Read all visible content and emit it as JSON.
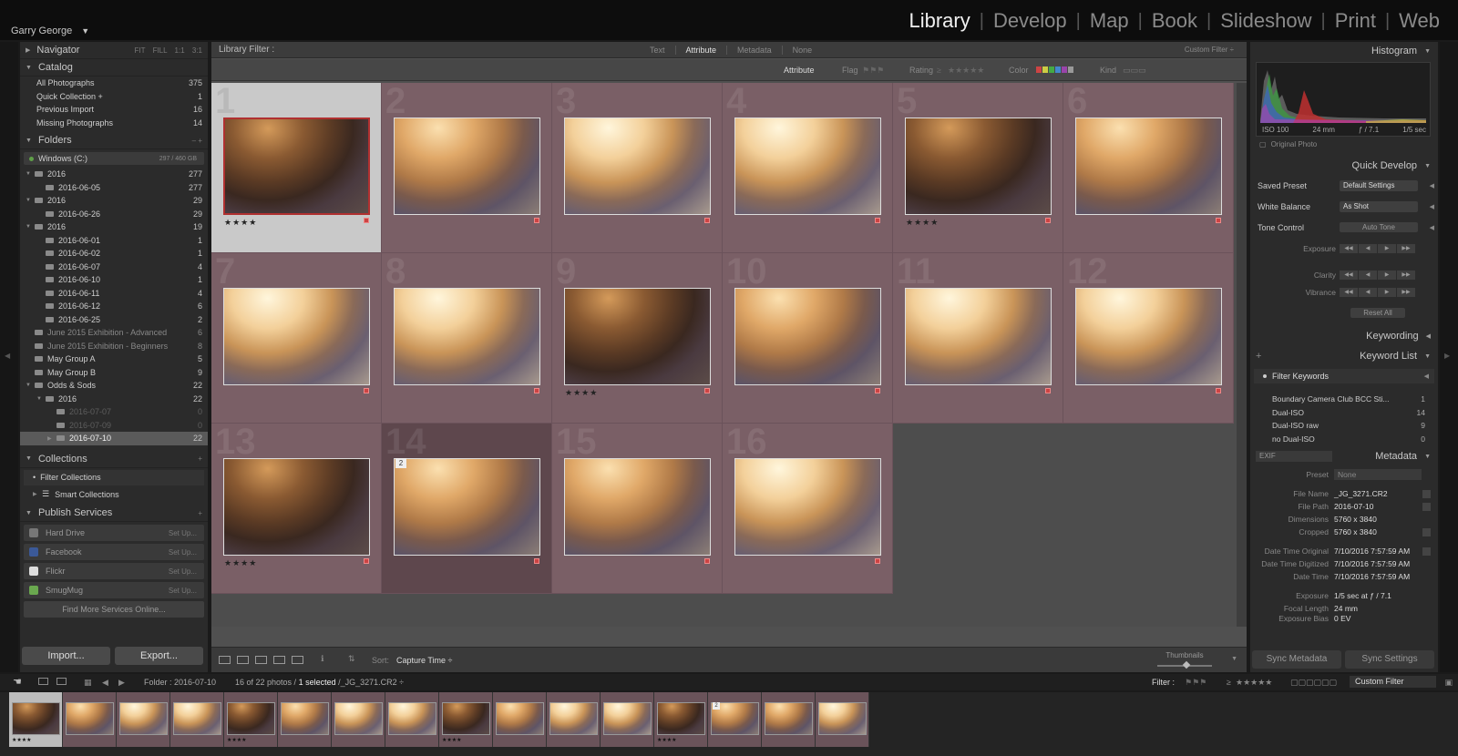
{
  "identity": {
    "name": "Garry George",
    "caret": "▼"
  },
  "modules": [
    "Library",
    "Develop",
    "Map",
    "Book",
    "Slideshow",
    "Print",
    "Web"
  ],
  "left": {
    "navigator": {
      "title": "Navigator",
      "zoom_options": [
        "FIT",
        "FILL",
        "1:1",
        "3:1"
      ]
    },
    "catalog": {
      "title": "Catalog",
      "items": [
        {
          "label": "All Photographs",
          "count": "375"
        },
        {
          "label": "Quick Collection +",
          "count": "1"
        },
        {
          "label": "Previous Import",
          "count": "16"
        },
        {
          "label": "Missing Photographs",
          "count": "14"
        }
      ]
    },
    "folders": {
      "title": "Folders",
      "controls": "–  +",
      "volume": {
        "label": "Windows (C:)",
        "space": "297 / 460 GB"
      },
      "items": [
        {
          "label": "2016",
          "count": "277"
        },
        {
          "label": "2016-06-05",
          "count": "277"
        },
        {
          "label": "2016",
          "count": "29"
        },
        {
          "label": "2016-06-26",
          "count": "29"
        },
        {
          "label": "2016",
          "count": "19"
        },
        {
          "label": "2016-06-01",
          "count": "1"
        },
        {
          "label": "2016-06-02",
          "count": "1"
        },
        {
          "label": "2016-06-07",
          "count": "4"
        },
        {
          "label": "2016-06-10",
          "count": "1"
        },
        {
          "label": "2016-06-11",
          "count": "4"
        },
        {
          "label": "2016-06-12",
          "count": "6"
        },
        {
          "label": "2016-06-25",
          "count": "2"
        },
        {
          "label": "June 2015 Exhibition - Advanced",
          "count": "6"
        },
        {
          "label": "June 2015 Exhibition - Beginners",
          "count": "8"
        },
        {
          "label": "May Group A",
          "count": "5"
        },
        {
          "label": "May Group B",
          "count": "9"
        },
        {
          "label": "Odds & Sods",
          "count": "22"
        },
        {
          "label": "2016",
          "count": "22"
        },
        {
          "label": "2016-07-07",
          "count": "0"
        },
        {
          "label": "2016-07-09",
          "count": "0"
        },
        {
          "label": "2016-07-10",
          "count": "22"
        }
      ]
    },
    "collections": {
      "title": "Collections",
      "plus": "+",
      "filter": "Filter Collections",
      "smart": "Smart Collections"
    },
    "publish": {
      "title": "Publish Services",
      "plus": "+",
      "services": [
        {
          "label": "Hard Drive",
          "action": "Set Up...",
          "color": "#777777"
        },
        {
          "label": "Facebook",
          "action": "Set Up...",
          "color": "#3b5998"
        },
        {
          "label": "Flickr",
          "action": "Set Up...",
          "color": "#dddddd"
        },
        {
          "label": "SmugMug",
          "action": "Set Up...",
          "color": "#6aa84f"
        }
      ],
      "find_more": "Find More Services Online..."
    },
    "import_label": "Import...",
    "export_label": "Export..."
  },
  "filter": {
    "title": "Library Filter :",
    "options": [
      "Text",
      "Attribute",
      "Metadata",
      "None"
    ],
    "active": "Attribute",
    "custom": "Custom Filter ÷",
    "attr": {
      "attribute": "Attribute",
      "flag": "Flag",
      "rating": "Rating",
      "rating_op": "≥",
      "color": "Color",
      "kind": "Kind"
    }
  },
  "grid": {
    "cells": [
      {
        "index": "1",
        "tone": "pd",
        "stars": "★★★★",
        "selected": true
      },
      {
        "index": "2",
        "tone": "pm",
        "stars": ""
      },
      {
        "index": "3",
        "tone": "pl",
        "stars": ""
      },
      {
        "index": "4",
        "tone": "pl",
        "stars": ""
      },
      {
        "index": "5",
        "tone": "pd",
        "stars": "★★★★"
      },
      {
        "index": "6",
        "tone": "pm",
        "stars": ""
      },
      {
        "index": "7",
        "tone": "pl",
        "stars": ""
      },
      {
        "index": "8",
        "tone": "pl",
        "stars": ""
      },
      {
        "index": "9",
        "tone": "pd",
        "stars": "★★★★"
      },
      {
        "index": "10",
        "tone": "pm",
        "stars": ""
      },
      {
        "index": "11",
        "tone": "pl",
        "stars": ""
      },
      {
        "index": "12",
        "tone": "pl",
        "stars": ""
      },
      {
        "index": "13",
        "tone": "pd",
        "stars": "★★★★"
      },
      {
        "index": "14",
        "tone": "pm",
        "stars": "",
        "stack": "2",
        "dark": true
      },
      {
        "index": "15",
        "tone": "pm",
        "stars": ""
      },
      {
        "index": "16",
        "tone": "pl",
        "stars": ""
      }
    ]
  },
  "toolbar": {
    "sort_label": "Sort:",
    "sort_value": "Capture Time ÷",
    "thumbnails": "Thumbnails"
  },
  "right": {
    "histogram": {
      "title": "Histogram",
      "iso": "ISO 100",
      "focal": "24 mm",
      "aperture": "ƒ / 7.1",
      "shutter": "1/5 sec",
      "original": "Original Photo"
    },
    "quick_develop": {
      "title": "Quick Develop",
      "saved_preset_label": "Saved Preset",
      "saved_preset": "Default Settings",
      "wb_label": "White Balance",
      "wb": "As Shot",
      "tone_label": "Tone Control",
      "auto_tone": "Auto Tone",
      "exposure": "Exposure",
      "clarity": "Clarity",
      "vibrance": "Vibrance",
      "reset": "Reset All"
    },
    "keywording": {
      "title": "Keywording"
    },
    "keyword_list": {
      "title": "Keyword List",
      "plus": "+",
      "filter": "Filter Keywords",
      "items": [
        {
          "label": "Boundary Camera Club BCC Sti...",
          "count": "1"
        },
        {
          "label": "Dual-ISO",
          "count": "14"
        },
        {
          "label": "Dual-ISO raw",
          "count": "9"
        },
        {
          "label": "no Dual-ISO",
          "count": "0"
        }
      ]
    },
    "metadata": {
      "title": "Metadata",
      "set": "EXIF",
      "preset_label": "Preset",
      "preset": "None",
      "fields": [
        {
          "k": "File Name",
          "v": "_JG_3271.CR2"
        },
        {
          "k": "File Path",
          "v": "2016-07-10"
        },
        {
          "k": "Dimensions",
          "v": "5760 x 3840"
        },
        {
          "k": "Cropped",
          "v": "5760 x 3840"
        },
        {
          "k": "Date Time Original",
          "v": "7/10/2016 7:57:59 AM"
        },
        {
          "k": "Date Time Digitized",
          "v": "7/10/2016 7:57:59 AM"
        },
        {
          "k": "Date Time",
          "v": "7/10/2016 7:57:59 AM"
        },
        {
          "k": "Exposure",
          "v": "1/5 sec at ƒ / 7.1"
        },
        {
          "k": "Focal Length",
          "v": "24 mm"
        },
        {
          "k": "Exposure Bias",
          "v": "0 EV"
        }
      ]
    },
    "sync_metadata": "Sync Metadata",
    "sync_settings": "Sync Settings"
  },
  "filmstrip_bar": {
    "folder_label": "Folder : 2016-07-10",
    "count": "16 of 22 photos /",
    "selected": "1 selected",
    "file": "/_JG_3271.CR2 ÷",
    "filter_label": "Filter :",
    "rating_op": "≥",
    "stars": "★★★★★",
    "custom": "Custom Filter"
  },
  "filmstrip": [
    {
      "tone": "pd",
      "stars": "★★★★",
      "selected": true
    },
    {
      "tone": "pm"
    },
    {
      "tone": "pl"
    },
    {
      "tone": "pl"
    },
    {
      "tone": "pd",
      "stars": "★★★★"
    },
    {
      "tone": "pm"
    },
    {
      "tone": "pl"
    },
    {
      "tone": "pl"
    },
    {
      "tone": "pd",
      "stars": "★★★★"
    },
    {
      "tone": "pm"
    },
    {
      "tone": "pl"
    },
    {
      "tone": "pl"
    },
    {
      "tone": "pd",
      "stars": "★★★★"
    },
    {
      "tone": "pm",
      "stack": "2"
    },
    {
      "tone": "pm"
    },
    {
      "tone": "pl"
    }
  ]
}
